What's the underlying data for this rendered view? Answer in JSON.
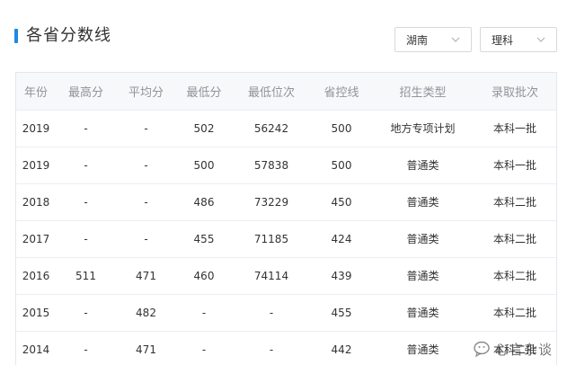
{
  "header": {
    "title": "各省分数线",
    "province_select": "湖南",
    "subject_select": "理科"
  },
  "table": {
    "columns": [
      "年份",
      "最高分",
      "平均分",
      "最低分",
      "最低位次",
      "省控线",
      "招生类型",
      "录取批次"
    ],
    "rows": [
      [
        "2019",
        "-",
        "-",
        "502",
        "56242",
        "500",
        "地方专项计划",
        "本科一批"
      ],
      [
        "2019",
        "-",
        "-",
        "500",
        "57838",
        "500",
        "普通类",
        "本科一批"
      ],
      [
        "2018",
        "-",
        "-",
        "486",
        "73229",
        "450",
        "普通类",
        "本科二批"
      ],
      [
        "2017",
        "-",
        "-",
        "455",
        "71185",
        "424",
        "普通类",
        "本科二批"
      ],
      [
        "2016",
        "511",
        "471",
        "460",
        "74114",
        "439",
        "普通类",
        "本科二批"
      ],
      [
        "2015",
        "-",
        "482",
        "-",
        "-",
        "455",
        "普通类",
        "本科二批"
      ],
      [
        "2014",
        "-",
        "471",
        "-",
        "-",
        "442",
        "普通类",
        "本科二批"
      ]
    ]
  },
  "watermark": {
    "text": "心言杂谈"
  },
  "colors": {
    "accent": "#1e88e5",
    "header_bg": "#f7f8fa",
    "border": "#e4e7ed"
  }
}
